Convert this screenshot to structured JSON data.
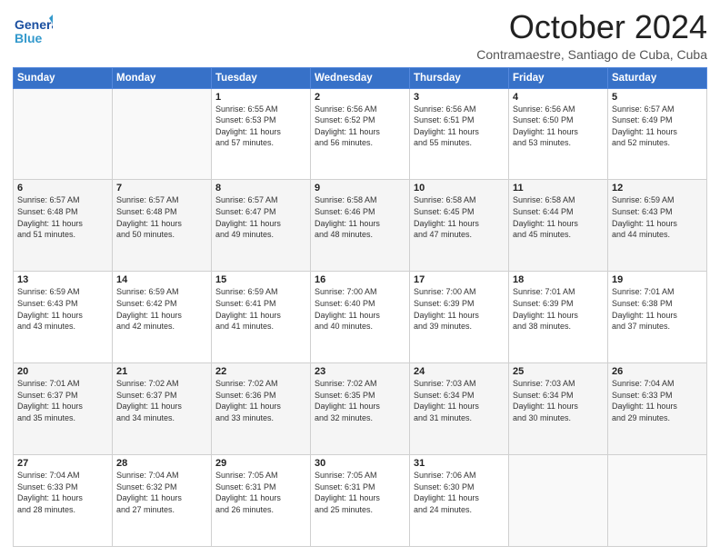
{
  "header": {
    "logo_line1": "General",
    "logo_line2": "Blue",
    "month_title": "October 2024",
    "subtitle": "Contramaestre, Santiago de Cuba, Cuba"
  },
  "days_of_week": [
    "Sunday",
    "Monday",
    "Tuesday",
    "Wednesday",
    "Thursday",
    "Friday",
    "Saturday"
  ],
  "weeks": [
    [
      {
        "day": "",
        "info": ""
      },
      {
        "day": "",
        "info": ""
      },
      {
        "day": "1",
        "info": "Sunrise: 6:55 AM\nSunset: 6:53 PM\nDaylight: 11 hours\nand 57 minutes."
      },
      {
        "day": "2",
        "info": "Sunrise: 6:56 AM\nSunset: 6:52 PM\nDaylight: 11 hours\nand 56 minutes."
      },
      {
        "day": "3",
        "info": "Sunrise: 6:56 AM\nSunset: 6:51 PM\nDaylight: 11 hours\nand 55 minutes."
      },
      {
        "day": "4",
        "info": "Sunrise: 6:56 AM\nSunset: 6:50 PM\nDaylight: 11 hours\nand 53 minutes."
      },
      {
        "day": "5",
        "info": "Sunrise: 6:57 AM\nSunset: 6:49 PM\nDaylight: 11 hours\nand 52 minutes."
      }
    ],
    [
      {
        "day": "6",
        "info": "Sunrise: 6:57 AM\nSunset: 6:48 PM\nDaylight: 11 hours\nand 51 minutes."
      },
      {
        "day": "7",
        "info": "Sunrise: 6:57 AM\nSunset: 6:48 PM\nDaylight: 11 hours\nand 50 minutes."
      },
      {
        "day": "8",
        "info": "Sunrise: 6:57 AM\nSunset: 6:47 PM\nDaylight: 11 hours\nand 49 minutes."
      },
      {
        "day": "9",
        "info": "Sunrise: 6:58 AM\nSunset: 6:46 PM\nDaylight: 11 hours\nand 48 minutes."
      },
      {
        "day": "10",
        "info": "Sunrise: 6:58 AM\nSunset: 6:45 PM\nDaylight: 11 hours\nand 47 minutes."
      },
      {
        "day": "11",
        "info": "Sunrise: 6:58 AM\nSunset: 6:44 PM\nDaylight: 11 hours\nand 45 minutes."
      },
      {
        "day": "12",
        "info": "Sunrise: 6:59 AM\nSunset: 6:43 PM\nDaylight: 11 hours\nand 44 minutes."
      }
    ],
    [
      {
        "day": "13",
        "info": "Sunrise: 6:59 AM\nSunset: 6:43 PM\nDaylight: 11 hours\nand 43 minutes."
      },
      {
        "day": "14",
        "info": "Sunrise: 6:59 AM\nSunset: 6:42 PM\nDaylight: 11 hours\nand 42 minutes."
      },
      {
        "day": "15",
        "info": "Sunrise: 6:59 AM\nSunset: 6:41 PM\nDaylight: 11 hours\nand 41 minutes."
      },
      {
        "day": "16",
        "info": "Sunrise: 7:00 AM\nSunset: 6:40 PM\nDaylight: 11 hours\nand 40 minutes."
      },
      {
        "day": "17",
        "info": "Sunrise: 7:00 AM\nSunset: 6:39 PM\nDaylight: 11 hours\nand 39 minutes."
      },
      {
        "day": "18",
        "info": "Sunrise: 7:01 AM\nSunset: 6:39 PM\nDaylight: 11 hours\nand 38 minutes."
      },
      {
        "day": "19",
        "info": "Sunrise: 7:01 AM\nSunset: 6:38 PM\nDaylight: 11 hours\nand 37 minutes."
      }
    ],
    [
      {
        "day": "20",
        "info": "Sunrise: 7:01 AM\nSunset: 6:37 PM\nDaylight: 11 hours\nand 35 minutes."
      },
      {
        "day": "21",
        "info": "Sunrise: 7:02 AM\nSunset: 6:37 PM\nDaylight: 11 hours\nand 34 minutes."
      },
      {
        "day": "22",
        "info": "Sunrise: 7:02 AM\nSunset: 6:36 PM\nDaylight: 11 hours\nand 33 minutes."
      },
      {
        "day": "23",
        "info": "Sunrise: 7:02 AM\nSunset: 6:35 PM\nDaylight: 11 hours\nand 32 minutes."
      },
      {
        "day": "24",
        "info": "Sunrise: 7:03 AM\nSunset: 6:34 PM\nDaylight: 11 hours\nand 31 minutes."
      },
      {
        "day": "25",
        "info": "Sunrise: 7:03 AM\nSunset: 6:34 PM\nDaylight: 11 hours\nand 30 minutes."
      },
      {
        "day": "26",
        "info": "Sunrise: 7:04 AM\nSunset: 6:33 PM\nDaylight: 11 hours\nand 29 minutes."
      }
    ],
    [
      {
        "day": "27",
        "info": "Sunrise: 7:04 AM\nSunset: 6:33 PM\nDaylight: 11 hours\nand 28 minutes."
      },
      {
        "day": "28",
        "info": "Sunrise: 7:04 AM\nSunset: 6:32 PM\nDaylight: 11 hours\nand 27 minutes."
      },
      {
        "day": "29",
        "info": "Sunrise: 7:05 AM\nSunset: 6:31 PM\nDaylight: 11 hours\nand 26 minutes."
      },
      {
        "day": "30",
        "info": "Sunrise: 7:05 AM\nSunset: 6:31 PM\nDaylight: 11 hours\nand 25 minutes."
      },
      {
        "day": "31",
        "info": "Sunrise: 7:06 AM\nSunset: 6:30 PM\nDaylight: 11 hours\nand 24 minutes."
      },
      {
        "day": "",
        "info": ""
      },
      {
        "day": "",
        "info": ""
      }
    ]
  ]
}
